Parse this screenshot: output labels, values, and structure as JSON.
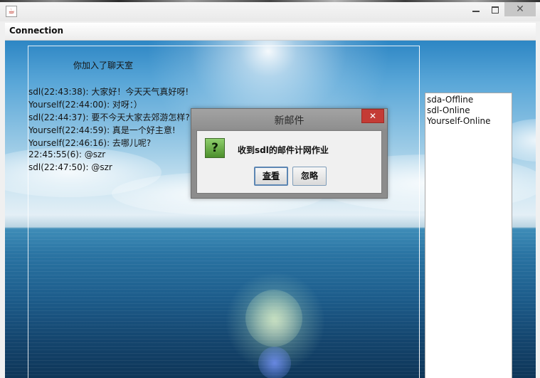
{
  "window": {
    "app_icon": "java-cup-icon",
    "controls": {
      "minimize": "minimize-icon",
      "maximize": "maximize-icon",
      "close": "close-icon",
      "close_glyph": "✕"
    }
  },
  "menu": {
    "items": [
      "Connection"
    ]
  },
  "chat": {
    "joined_notice": "你加入了聊天室",
    "messages": [
      "sdl(22:43:38): 大家好！今天天气真好呀!",
      "Yourself(22:44:00): 对呀：）",
      "sdl(22:44:37): 要不今天大家去郊游怎样?",
      "Yourself(22:44:59): 真是一个好主意!",
      "Yourself(22:46:16): 去哪儿呢?",
      "22:45:55(6): @szr",
      "sdl(22:47:50): @szr"
    ]
  },
  "users": [
    "sda-Offline",
    "sdl-Online",
    "Yourself-Online"
  ],
  "dialog": {
    "title": "新邮件",
    "close_glyph": "✕",
    "icon": "question-icon",
    "icon_glyph": "?",
    "message": "收到sdl的邮件计网作业",
    "buttons": {
      "view": "查看",
      "ignore": "忽略"
    }
  },
  "colors": {
    "dialog_close": "#c43b35",
    "question_icon": "#4c8f2c",
    "window_close": "#c7c7c7"
  }
}
